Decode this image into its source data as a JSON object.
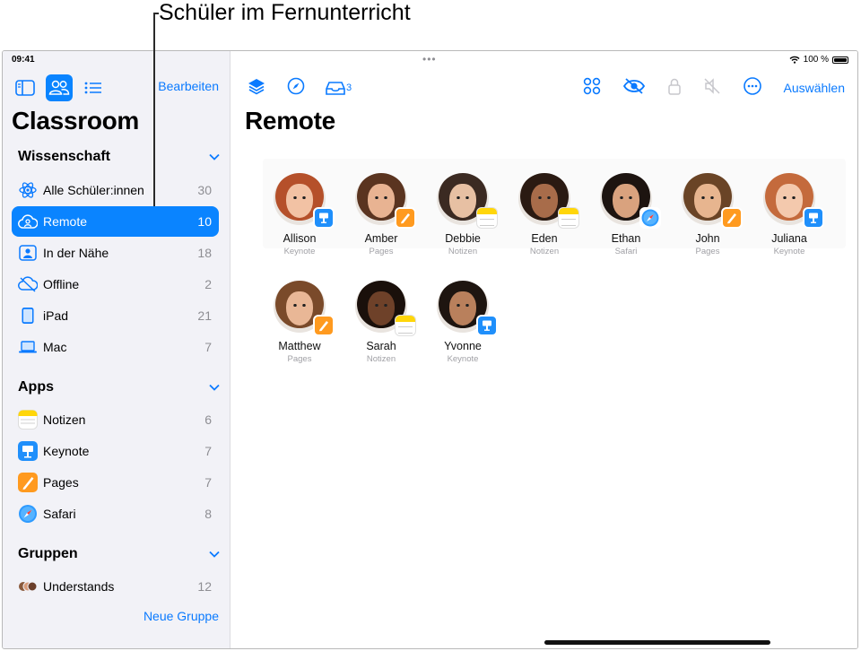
{
  "callout": {
    "text": "Schüler im Fernunterricht"
  },
  "status_bar": {
    "time": "09:41",
    "battery": "100 %"
  },
  "sidebar": {
    "edit_label": "Bearbeiten",
    "app_title": "Classroom",
    "sections": [
      {
        "title": "Wissenschaft",
        "items": [
          {
            "label": "Alle Schüler:innen",
            "count": "30",
            "icon": "atom-icon"
          },
          {
            "label": "Remote",
            "count": "10",
            "icon": "cloud-person-icon",
            "selected": true
          },
          {
            "label": "In der Nähe",
            "count": "18",
            "icon": "person-square-icon"
          },
          {
            "label": "Offline",
            "count": "2",
            "icon": "cloud-offline-icon"
          },
          {
            "label": "iPad",
            "count": "21",
            "icon": "ipad-icon"
          },
          {
            "label": "Mac",
            "count": "7",
            "icon": "laptop-icon"
          }
        ]
      },
      {
        "title": "Apps",
        "items": [
          {
            "label": "Notizen",
            "count": "6",
            "icon": "notes-app-icon"
          },
          {
            "label": "Keynote",
            "count": "7",
            "icon": "keynote-app-icon"
          },
          {
            "label": "Pages",
            "count": "7",
            "icon": "pages-app-icon"
          },
          {
            "label": "Safari",
            "count": "8",
            "icon": "safari-app-icon"
          }
        ]
      },
      {
        "title": "Gruppen",
        "items": [
          {
            "label": "Understands",
            "count": "12",
            "icon": "group-avatars-icon"
          }
        ]
      }
    ],
    "new_group_label": "Neue Gruppe"
  },
  "main": {
    "title": "Remote",
    "toolbar": {
      "inbox_count": "3",
      "select_label": "Auswählen"
    },
    "students": [
      {
        "name": "Allison",
        "app": "Keynote",
        "skin": "#f2c2a4",
        "hair": "#b5502a",
        "badge": "keynote"
      },
      {
        "name": "Amber",
        "app": "Pages",
        "skin": "#e8b392",
        "hair": "#5a3420",
        "badge": "pages"
      },
      {
        "name": "Debbie",
        "app": "Notizen",
        "skin": "#e7c0a3",
        "hair": "#3b2a22",
        "badge": "notes"
      },
      {
        "name": "Eden",
        "app": "Notizen",
        "skin": "#a86c4a",
        "hair": "#2a1a12",
        "badge": "notes"
      },
      {
        "name": "Ethan",
        "app": "Safari",
        "skin": "#d9a27e",
        "hair": "#1d1410",
        "badge": "safari"
      },
      {
        "name": "John",
        "app": "Pages",
        "skin": "#e7b58f",
        "hair": "#6a4426",
        "badge": "pages"
      },
      {
        "name": "Juliana",
        "app": "Keynote",
        "skin": "#f4c9ad",
        "hair": "#c46a3c",
        "badge": "keynote"
      },
      {
        "name": "Matthew",
        "app": "Pages",
        "skin": "#e9b796",
        "hair": "#7a4a2a",
        "badge": "pages"
      },
      {
        "name": "Sarah",
        "app": "Notizen",
        "skin": "#6e4129",
        "hair": "#1a100b",
        "badge": "notes"
      },
      {
        "name": "Yvonne",
        "app": "Keynote",
        "skin": "#b9805c",
        "hair": "#1e1510",
        "badge": "keynote"
      }
    ]
  }
}
